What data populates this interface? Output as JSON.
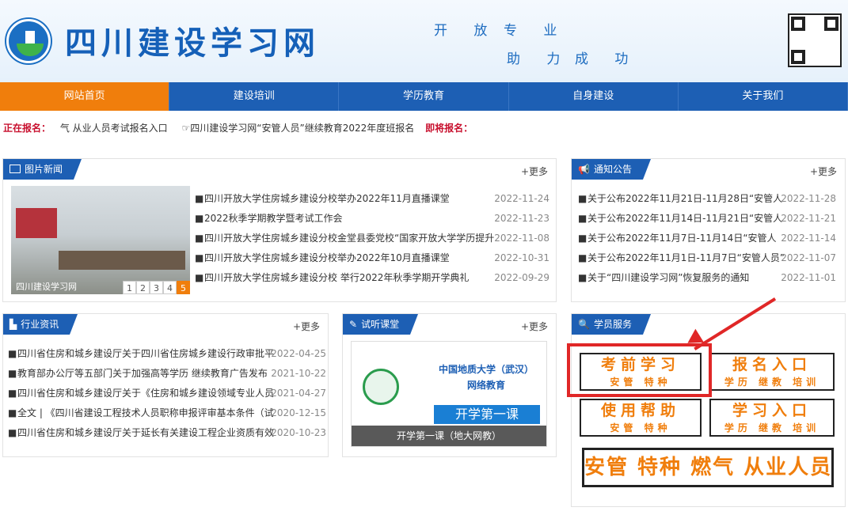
{
  "header": {
    "title": "四川建设学习网",
    "slogan_1": "开 放",
    "slogan_2": "专 业",
    "slogan_3": "助 力",
    "slogan_4": "成 功"
  },
  "nav": [
    "网站首页",
    "建设培训",
    "学历教育",
    "自身建设",
    "关于我们"
  ],
  "ticker": {
    "label_now": "正在报名：",
    "item_1": "气 从业人员考试报名入口",
    "item_2": "四川建设学习网“安管人员”继续教育2022年度班报名",
    "label_soon": "即将报名："
  },
  "photo_news": {
    "title": "图片新闻",
    "more": "+更多",
    "caption": "四川建设学习网",
    "pages": [
      "1",
      "2",
      "3",
      "4",
      "5"
    ],
    "items": [
      {
        "title": "四川开放大学住房城乡建设分校举办2022年11月直播课堂",
        "date": "2022-11-24"
      },
      {
        "title": "2022秋季学期教学暨考试工作会",
        "date": "2022-11-23"
      },
      {
        "title": "四川开放大学住房城乡建设分校金堂县委党校“国家开放大学学历提升",
        "date": "2022-11-08"
      },
      {
        "title": "四川开放大学住房城乡建设分校举办2022年10月直播课堂",
        "date": "2022-10-31"
      },
      {
        "title": "四川开放大学住房城乡建设分校 举行2022年秋季学期开学典礼",
        "date": "2022-09-29"
      }
    ]
  },
  "notice": {
    "title": "通知公告",
    "more": "+更多",
    "items": [
      {
        "title": "关于公布2022年11月21日-11月28日“安管人",
        "date": "2022-11-28"
      },
      {
        "title": "关于公布2022年11月14日-11月21日“安管人",
        "date": "2022-11-21"
      },
      {
        "title": "关于公布2022年11月7日-11月14日“安管人",
        "date": "2022-11-14"
      },
      {
        "title": "关于公布2022年11月1日-11月7日“安管人员”",
        "date": "2022-11-07"
      },
      {
        "title": "关于“四川建设学习网”恢复服务的通知",
        "date": "2022-11-01"
      }
    ]
  },
  "industry": {
    "title": "行业资讯",
    "more": "+更多",
    "items": [
      {
        "title": "四川省住房和城乡建设厅关于四川省住房城乡建设行政审批平",
        "date": "2022-04-25"
      },
      {
        "title": "教育部办公厅等五部门关于加强高等学历 继续教育广告发布",
        "date": "2021-10-22"
      },
      {
        "title": "四川省住房和城乡建设厅关于《住房和城乡建设领域专业人员",
        "date": "2021-04-27"
      },
      {
        "title": "全文 | 《四川省建设工程技术人员职称申报评审基本条件（试",
        "date": "2020-12-15"
      },
      {
        "title": "四川省住房和城乡建设厅关于延长有关建设工程企业资质有效",
        "date": "2020-10-23"
      }
    ]
  },
  "trial": {
    "title": "试听课堂",
    "more": "+更多",
    "video_title_1": "中国地质大学（武汉）",
    "video_title_2": "网络教育",
    "banner": "开学第一课",
    "caption": "开学第一课（地大网教）"
  },
  "service": {
    "title": "学员服务",
    "b1_top": "考前学习",
    "b1_bot": "安管 特种",
    "b2_top": "报名入口",
    "b2_bot": "学历 继教 培训",
    "b3_top": "使用帮助",
    "b3_bot": "安管 特种",
    "b4_top": "学习入口",
    "b4_bot": "学历 继教 培训",
    "big": "安管 特种 燃气 从业人员考试报名入口"
  },
  "colors": {
    "nav": "#1d5fb4",
    "active": "#f07e0c",
    "highlight": "#e02727"
  }
}
